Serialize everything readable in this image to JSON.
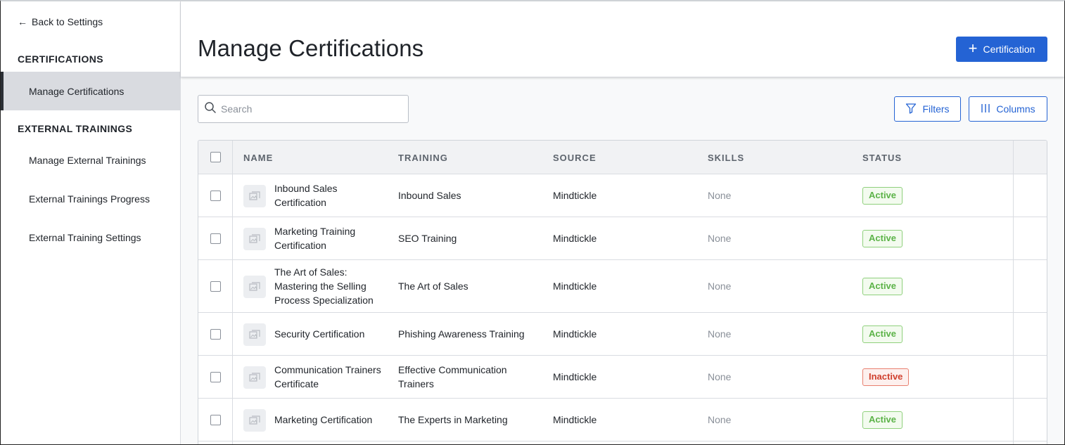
{
  "sidebar": {
    "back_label": "Back to Settings",
    "sections": [
      {
        "title": "CERTIFICATIONS",
        "items": [
          {
            "label": "Manage Certifications",
            "active": true
          }
        ]
      },
      {
        "title": "EXTERNAL TRAININGS",
        "items": [
          {
            "label": "Manage External Trainings",
            "active": false
          },
          {
            "label": "External Trainings Progress",
            "active": false
          },
          {
            "label": "External Training Settings",
            "active": false
          }
        ]
      }
    ]
  },
  "header": {
    "title": "Manage Certifications",
    "add_button_label": "Certification",
    "add_button_icon": "plus-icon"
  },
  "toolbar": {
    "search_placeholder": "Search",
    "search_value": "",
    "filters_label": "Filters",
    "columns_label": "Columns"
  },
  "table": {
    "columns": [
      "NAME",
      "TRAINING",
      "SOURCE",
      "SKILLS",
      "STATUS"
    ],
    "rows": [
      {
        "name_lines": [
          "Inbound Sales",
          "Certification"
        ],
        "training_lines": [
          "Inbound Sales"
        ],
        "source": "Mindtickle",
        "skills": "None",
        "status": "Active"
      },
      {
        "name_lines": [
          "Marketing Training",
          "Certification"
        ],
        "training_lines": [
          "SEO Training"
        ],
        "source": "Mindtickle",
        "skills": "None",
        "status": "Active"
      },
      {
        "name_lines": [
          "The Art of Sales:",
          "Mastering the Selling",
          "Process Specialization"
        ],
        "training_lines": [
          "The Art of Sales"
        ],
        "source": "Mindtickle",
        "skills": "None",
        "status": "Active"
      },
      {
        "name_lines": [
          "Security Certification"
        ],
        "training_lines": [
          "Phishing Awareness Training"
        ],
        "source": "Mindtickle",
        "skills": "None",
        "status": "Active"
      },
      {
        "name_lines": [
          "Communication Trainers",
          "Certificate"
        ],
        "training_lines": [
          "Effective Communication",
          "Trainers"
        ],
        "source": "Mindtickle",
        "skills": "None",
        "status": "Inactive"
      },
      {
        "name_lines": [
          "Marketing Certification"
        ],
        "training_lines": [
          "The Experts in Marketing"
        ],
        "source": "Mindtickle",
        "skills": "None",
        "status": "Active"
      }
    ]
  },
  "colors": {
    "primary": "#2463d4",
    "active_status": "#5cb348",
    "inactive_status": "#d0402e"
  }
}
